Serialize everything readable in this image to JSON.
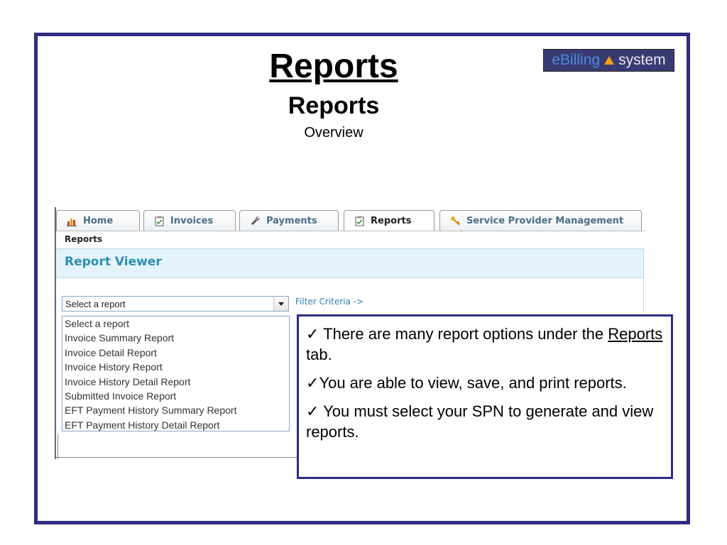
{
  "slide": {
    "title": "Reports",
    "subtitle": "Reports",
    "overview": "Overview",
    "logo": {
      "part1": "eBilling",
      "part2": "system"
    }
  },
  "app": {
    "tabs": [
      {
        "label": "Home",
        "icon": "bar-chart-icon"
      },
      {
        "label": "Invoices",
        "icon": "clipboard-icon"
      },
      {
        "label": "Payments",
        "icon": "wrench-icon"
      },
      {
        "label": "Reports",
        "icon": "clipboard-icon",
        "active": true
      },
      {
        "label": "Service Provider Management",
        "icon": "key-icon"
      }
    ],
    "breadcrumb": "Reports",
    "section_title": "Report Viewer",
    "select": {
      "value": "Select a report"
    },
    "filter_link": "Filter Criteria ->",
    "options": [
      "Select a report",
      "Invoice Summary Report",
      "Invoice Detail Report",
      "Invoice History Report",
      "Invoice History Detail Report",
      "Submitted Invoice Report",
      "EFT Payment History Summary Report",
      "EFT Payment History Detail Report"
    ]
  },
  "callout": {
    "check": "✓",
    "line1_pre": " There are many report options under the ",
    "line1_link": "Reports",
    "line1_post": " tab.",
    "line2": "You are able to view, save, and print reports.",
    "line3": " You must select your SPN to generate and view reports."
  },
  "colors": {
    "frame": "#2e2c82",
    "section_title": "#2c8fb3",
    "tab_text": "#4a6e86"
  }
}
